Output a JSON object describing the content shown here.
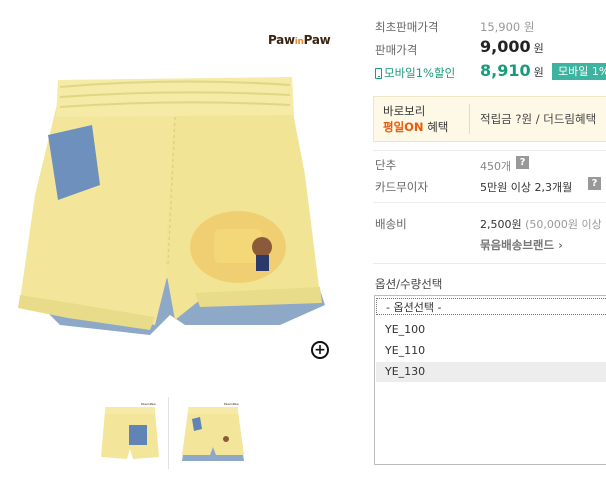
{
  "brand": {
    "logo_text": "PawinPaw"
  },
  "price": {
    "original_label": "최초판매가격",
    "original_price": "15,900 원",
    "sale_label": "판매가격",
    "sale_amount": "9,000",
    "currency": "원",
    "mobile_label": "모바일1%할인",
    "mobile_amount": "8,910",
    "mobile_badge": "모바일 1%"
  },
  "benefit": {
    "title_line1": "바로보리",
    "title_highlight": "평일ON",
    "title_suffix": " 혜택",
    "text": "적립금 ?원 / 더드림혜택"
  },
  "info": {
    "color_label": "단추",
    "color_value": "450개",
    "card_label": "카드무이자",
    "card_value": "5만원 이상 2,3개월",
    "shipping_label": "배송비",
    "shipping_value": "2,500원",
    "shipping_sub": " (50,000원 이상",
    "bundle_link": "묶음배송브랜드 ›",
    "help_glyph": "?"
  },
  "options": {
    "label": "옵션/수량선택",
    "items": [
      " - 옵션선택 -",
      "YE_100",
      "YE_110",
      "YE_130"
    ],
    "selected": "YE_130"
  },
  "colors": {
    "accent_green": "#1a9a7a",
    "badge_teal": "#3cb4a0",
    "highlight_orange": "#e85c0a",
    "benefit_bg": "#fef9e7"
  },
  "icons": {
    "zoom": "zoom-in-icon",
    "phone": "mobile-phone-icon"
  }
}
